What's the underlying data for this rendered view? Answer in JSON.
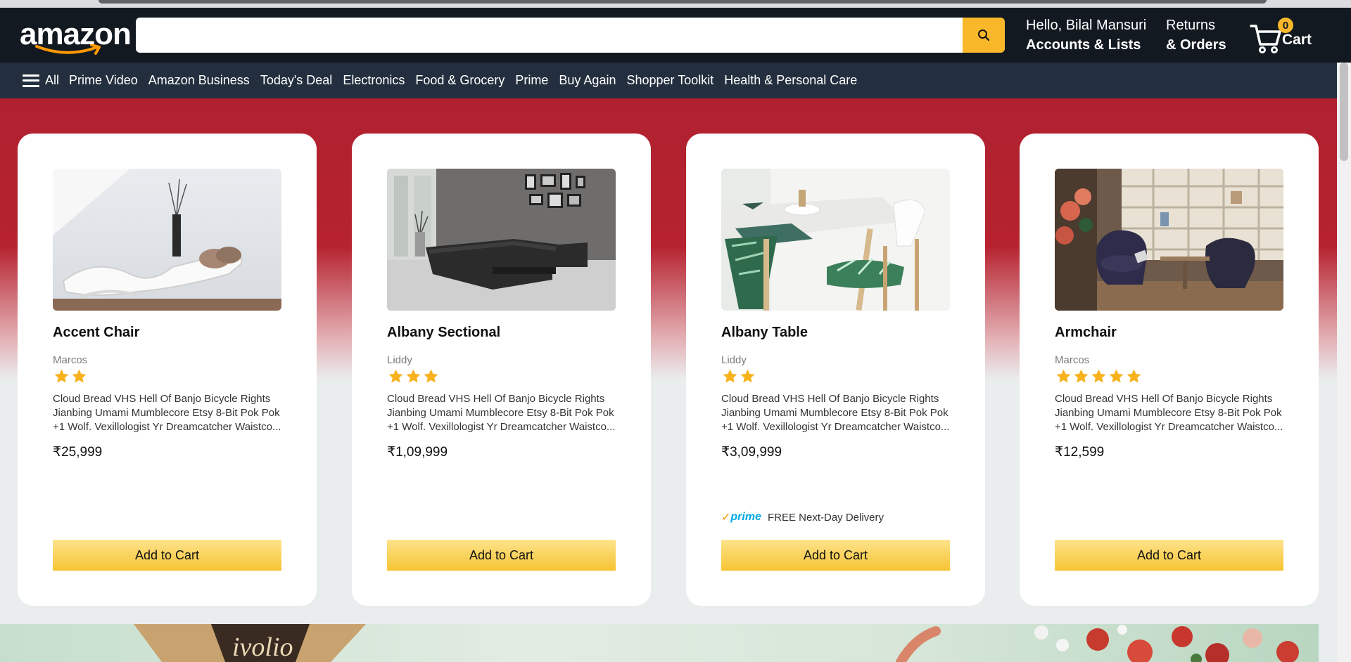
{
  "header": {
    "logo_text": "amazon",
    "search": {
      "placeholder": "",
      "value": ""
    },
    "account": {
      "greeting": "Hello, Bilal Mansuri",
      "label": "Accounts & Lists"
    },
    "returns": {
      "line1": "Returns",
      "line2": "& Orders"
    },
    "cart": {
      "count": "0",
      "label": "Cart"
    }
  },
  "nav": {
    "all_label": "All",
    "items": [
      "Prime Video",
      "Amazon Business",
      "Today's Deal",
      "Electronics",
      "Food & Grocery",
      "Prime",
      "Buy Again",
      "Shopper Toolkit",
      "Health & Personal Care"
    ]
  },
  "products": [
    {
      "title": "Accent Chair",
      "seller": "Marcos",
      "rating": 2,
      "description": "Cloud Bread VHS Hell Of Banjo Bicycle Rights Jianbing Umami Mumblecore Etsy 8-Bit Pok Pok +1 Wolf. Vexillologist Yr Dreamcatcher Waistco...",
      "price": "₹25,999",
      "prime": false,
      "button": "Add to Cart"
    },
    {
      "title": "Albany Sectional",
      "seller": "Liddy",
      "rating": 3,
      "description": "Cloud Bread VHS Hell Of Banjo Bicycle Rights Jianbing Umami Mumblecore Etsy 8-Bit Pok Pok +1 Wolf. Vexillologist Yr Dreamcatcher Waistco...",
      "price": "₹1,09,999",
      "prime": false,
      "button": "Add to Cart"
    },
    {
      "title": "Albany Table",
      "seller": "Liddy",
      "rating": 2,
      "description": "Cloud Bread VHS Hell Of Banjo Bicycle Rights Jianbing Umami Mumblecore Etsy 8-Bit Pok Pok +1 Wolf. Vexillologist Yr Dreamcatcher Waistco...",
      "price": "₹3,09,999",
      "prime": true,
      "prime_text": "FREE Next-Day Delivery",
      "prime_logo": "prime",
      "button": "Add to Cart"
    },
    {
      "title": "Armchair",
      "seller": "Marcos",
      "rating": 5,
      "description": "Cloud Bread VHS Hell Of Banjo Bicycle Rights Jianbing Umami Mumblecore Etsy 8-Bit Pok Pok +1 Wolf. Vexillologist Yr Dreamcatcher Waistco...",
      "price": "₹12,599",
      "prime": false,
      "button": "Add to Cart"
    }
  ],
  "colors": {
    "header_bg": "#131921",
    "nav_bg": "#232f3e",
    "accent": "#f9b82a",
    "hero_red": "#b6222f",
    "star": "#f7b21e"
  },
  "icons": {
    "search": "search-icon",
    "cart": "cart-icon",
    "menu": "hamburger-menu-icon",
    "star": "star-icon"
  }
}
